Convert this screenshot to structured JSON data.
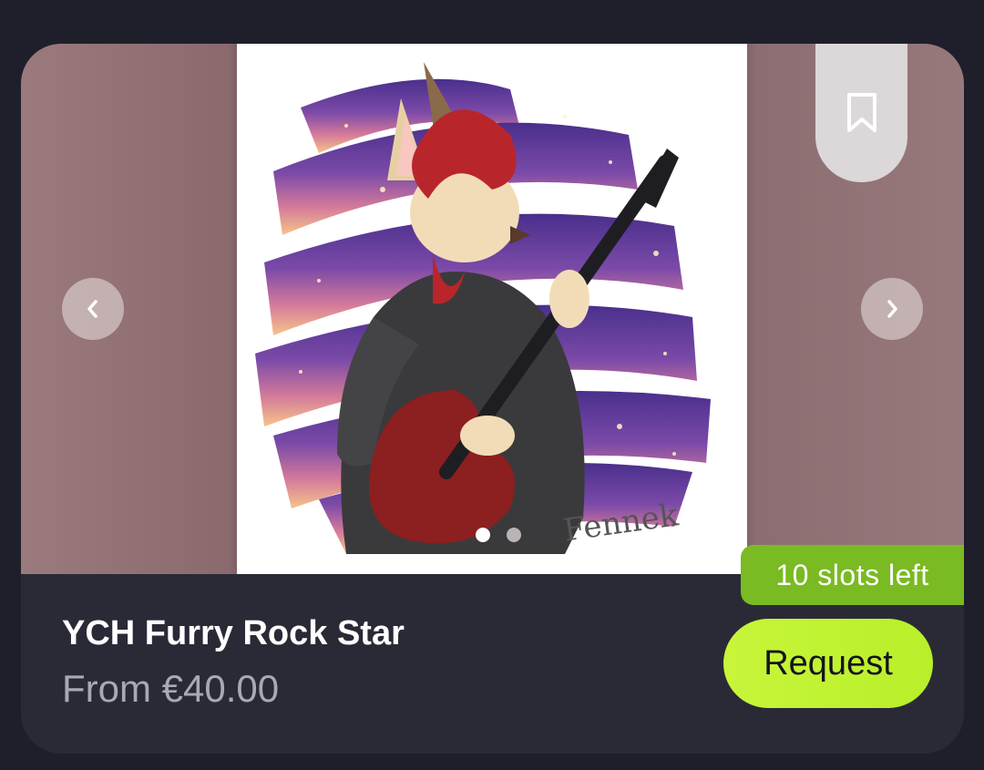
{
  "listing": {
    "title": "YCH Furry Rock Star",
    "price": "From €40.00",
    "slots_badge": "10 slots left",
    "request_label": "Request",
    "artist_signature": "Fennek"
  },
  "gallery": {
    "image_count": 2,
    "active_index": 0,
    "icons": {
      "bookmark": "bookmark-icon",
      "prev": "chevron-left-icon",
      "next": "chevron-right-icon"
    }
  },
  "colors": {
    "page_bg": "#1f1f2b",
    "card_bg": "#2a2a36",
    "badge_green": "#7aba22",
    "request_lime": "#c8f53a"
  }
}
